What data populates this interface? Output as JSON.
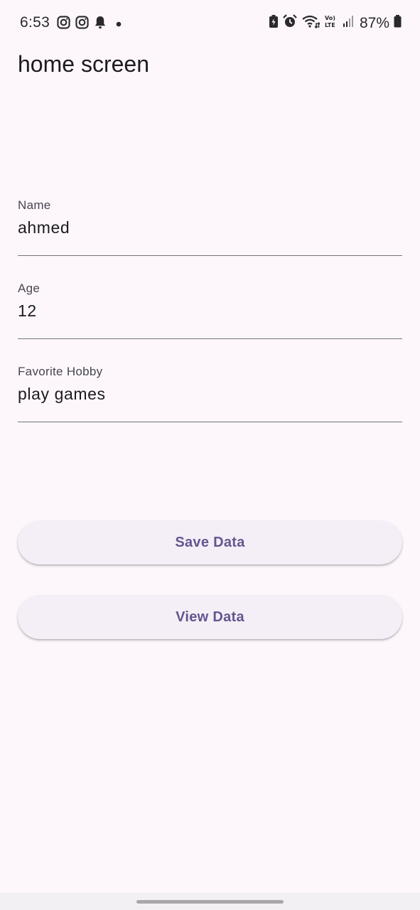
{
  "status_bar": {
    "time": "6:53",
    "battery_percent": "87%",
    "left_icons": [
      "instagram-icon",
      "instagram-icon",
      "notification-bell-icon",
      "dot-icon"
    ],
    "right_icons": [
      "battery-saver-icon",
      "alarm-icon",
      "wifi-icon",
      "volte-icon",
      "signal-icon",
      "battery-icon"
    ]
  },
  "app_bar": {
    "title": "home screen"
  },
  "form": {
    "name": {
      "label": "Name",
      "value": "ahmed"
    },
    "age": {
      "label": "Age",
      "value": "12"
    },
    "hobby": {
      "label": "Favorite Hobby",
      "value": "play games"
    }
  },
  "actions": {
    "save_label": "Save Data",
    "view_label": "View Data"
  },
  "colors": {
    "background": "#fdf7fc",
    "button_text": "#65558f",
    "button_bg": "#f4eff6"
  }
}
